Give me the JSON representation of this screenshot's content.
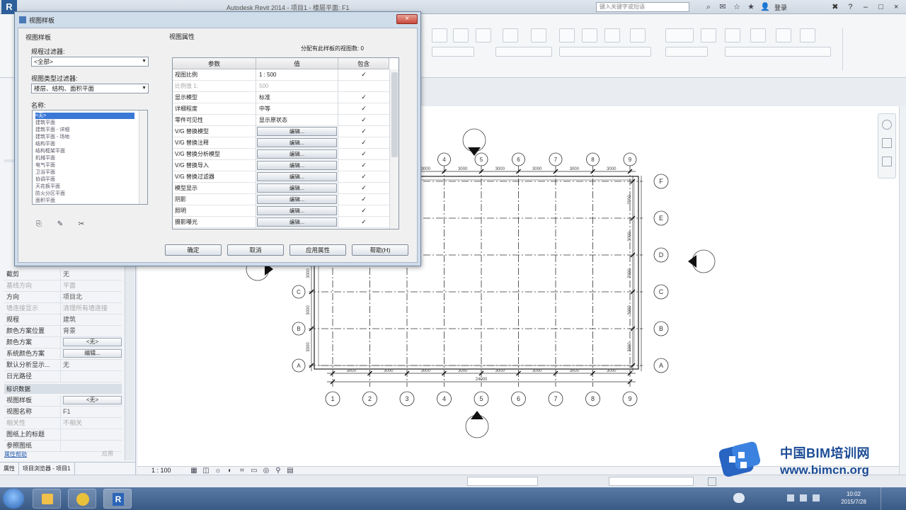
{
  "titlebar": {
    "app_logo": "R",
    "title": "Autodesk Revit 2014 - 项目1 - 楼层平面: F1",
    "search_placeholder": "键入关键字或短语",
    "login": "登录",
    "help": "?"
  },
  "properties": {
    "rows": [
      {
        "k": "截剪",
        "v": "无"
      },
      {
        "k": "基线方向",
        "v": "平面",
        "grey": true
      },
      {
        "k": "方向",
        "v": "项目北"
      },
      {
        "k": "墙连接显示",
        "v": "清理所有墙连接",
        "grey": true
      },
      {
        "k": "规程",
        "v": "建筑"
      },
      {
        "k": "颜色方案位置",
        "v": "背景"
      },
      {
        "k": "颜色方案",
        "btn": "<无>"
      },
      {
        "k": "系统颜色方案",
        "btn": "编辑..."
      },
      {
        "k": "默认分析显示...",
        "v": "无"
      },
      {
        "k": "日光路径",
        "v": ""
      }
    ],
    "section_ident": "标识数据",
    "id_rows": [
      {
        "k": "视图样板",
        "btn": "<无>"
      },
      {
        "k": "视图名称",
        "v": "F1"
      },
      {
        "k": "相关性",
        "v": "不相关",
        "grey": true
      },
      {
        "k": "图纸上的标题",
        "v": ""
      },
      {
        "k": "参照图纸",
        "v": ""
      }
    ],
    "help_link": "属性帮助",
    "apply": "应用"
  },
  "palette_tabs": [
    "属性",
    "项目浏览器 - 项目1"
  ],
  "view_scale": "1 : 100",
  "drawing": {
    "grid_cols": [
      "1",
      "2",
      "3",
      "4",
      "5",
      "6",
      "7",
      "8",
      "9"
    ],
    "grid_rows": [
      "A",
      "B",
      "C",
      "D",
      "E",
      "F"
    ],
    "bay_dim": "3000",
    "total_dim": "24000"
  },
  "dialog": {
    "title": "视图样板",
    "left_heading": "视图样板",
    "discipline_label": "规程过滤器:",
    "discipline_value": "<全部>",
    "viewtype_label": "视图类型过滤器:",
    "viewtype_value": "楼层、结构、面积平面",
    "names_label": "名称:",
    "names": [
      "<无>",
      "建筑平面",
      "建筑平面 - 详细",
      "建筑平面 - 场地",
      "结构平面",
      "结构框架平面",
      "机械平面",
      "电气平面",
      "卫浴平面",
      "协调平面",
      "天花板平面",
      "防火分区平面",
      "面积平面"
    ],
    "right_heading": "视图属性",
    "include_count_label": "分配有此样板的视图数:",
    "include_count": "0",
    "headers": {
      "param": "参数",
      "value": "值",
      "include": "包含"
    },
    "rows": [
      {
        "param": "视图比例",
        "value": "1 : 500",
        "include": true
      },
      {
        "param": "比例值 1:",
        "value": "500",
        "include": false,
        "grey": true
      },
      {
        "param": "显示模型",
        "value": "标准",
        "include": true
      },
      {
        "param": "详细程度",
        "value": "中等",
        "include": true
      },
      {
        "param": "零件可见性",
        "value": "显示原状态",
        "include": true
      },
      {
        "param": "V/G 替换模型",
        "edit": "编辑...",
        "include": true
      },
      {
        "param": "V/G 替换注释",
        "edit": "编辑...",
        "include": true
      },
      {
        "param": "V/G 替换分析模型",
        "edit": "编辑...",
        "include": true
      },
      {
        "param": "V/G 替换导入",
        "edit": "编辑...",
        "include": true
      },
      {
        "param": "V/G 替换过滤器",
        "edit": "编辑...",
        "include": true
      },
      {
        "param": "模型显示",
        "edit": "编辑...",
        "include": true
      },
      {
        "param": "阴影",
        "edit": "编辑...",
        "include": true
      },
      {
        "param": "照明",
        "edit": "编辑...",
        "include": true
      },
      {
        "param": "摄影曝光",
        "edit": "编辑...",
        "include": true
      }
    ],
    "buttons": {
      "ok": "确定",
      "cancel": "取消",
      "apply_props": "应用属性",
      "help": "帮助(H)"
    }
  },
  "watermark": {
    "brand": "中国BIM培训网",
    "url": "www.bimcn.org"
  },
  "taskbar": {
    "clock_time": "10:02",
    "clock_date": "2015/7/28"
  },
  "colors": {
    "accent": "#1c4c95",
    "close": "#c9473a"
  }
}
